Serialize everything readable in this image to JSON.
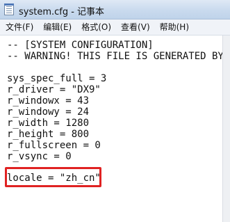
{
  "window": {
    "title": "system.cfg - 记事本",
    "icon": "notepad-icon"
  },
  "menu": {
    "items": [
      "文件(F)",
      "编辑(E)",
      "格式(O)",
      "查看(V)",
      "帮助(H)"
    ]
  },
  "editor": {
    "lines": [
      "-- [SYSTEM CONFIGURATION]",
      "-- WARNING! THIS FILE IS GENERATED BY TH",
      "",
      "sys_spec_full = 3",
      "r_driver = \"DX9\"",
      "r_windowx = 43",
      "r_windowy = 24",
      "r_width = 1280",
      "r_height = 800",
      "r_fullscreen = 0",
      "r_vsync = 0",
      "",
      "locale = \"zh_cn\""
    ],
    "highlight_color": "#e02222"
  }
}
